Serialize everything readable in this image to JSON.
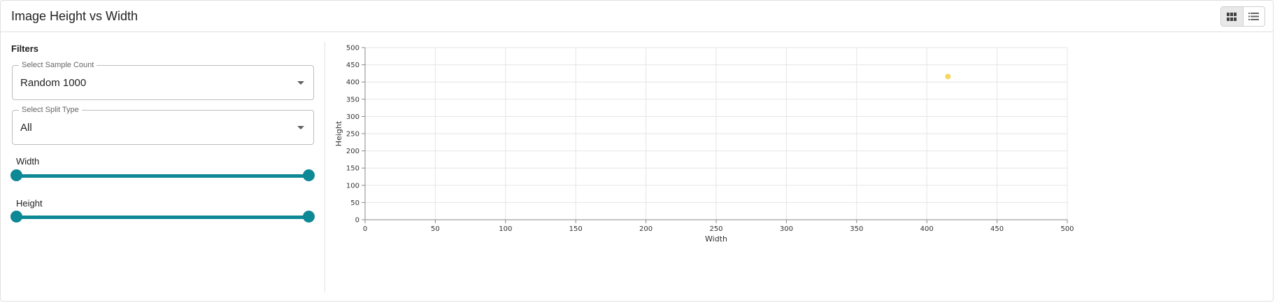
{
  "header": {
    "title": "Image Height vs Width",
    "view_toggle": {
      "selected": "grid",
      "options": [
        "grid-view",
        "list-view"
      ]
    }
  },
  "filters": {
    "heading": "Filters",
    "sample_count": {
      "label": "Select Sample Count",
      "value": "Random 1000"
    },
    "split_type": {
      "label": "Select Split Type",
      "value": "All"
    },
    "width_slider": {
      "label": "Width",
      "range": [
        0,
        1
      ]
    },
    "height_slider": {
      "label": "Height",
      "range": [
        0,
        1
      ]
    }
  },
  "colors": {
    "accent": "#0d8895",
    "point": "#f5d14a",
    "grid": "#e5e5e5",
    "axis": "#888888"
  },
  "chart_data": {
    "type": "scatter",
    "title": "",
    "xlabel": "Width",
    "ylabel": "Height",
    "xlim": [
      0,
      500
    ],
    "ylim": [
      0,
      500
    ],
    "xticks": [
      0,
      50,
      100,
      150,
      200,
      250,
      300,
      350,
      400,
      450,
      500
    ],
    "yticks": [
      0,
      50,
      100,
      150,
      200,
      250,
      300,
      350,
      400,
      450,
      500
    ],
    "grid": true,
    "points": [
      {
        "x": 415,
        "y": 416
      }
    ]
  }
}
